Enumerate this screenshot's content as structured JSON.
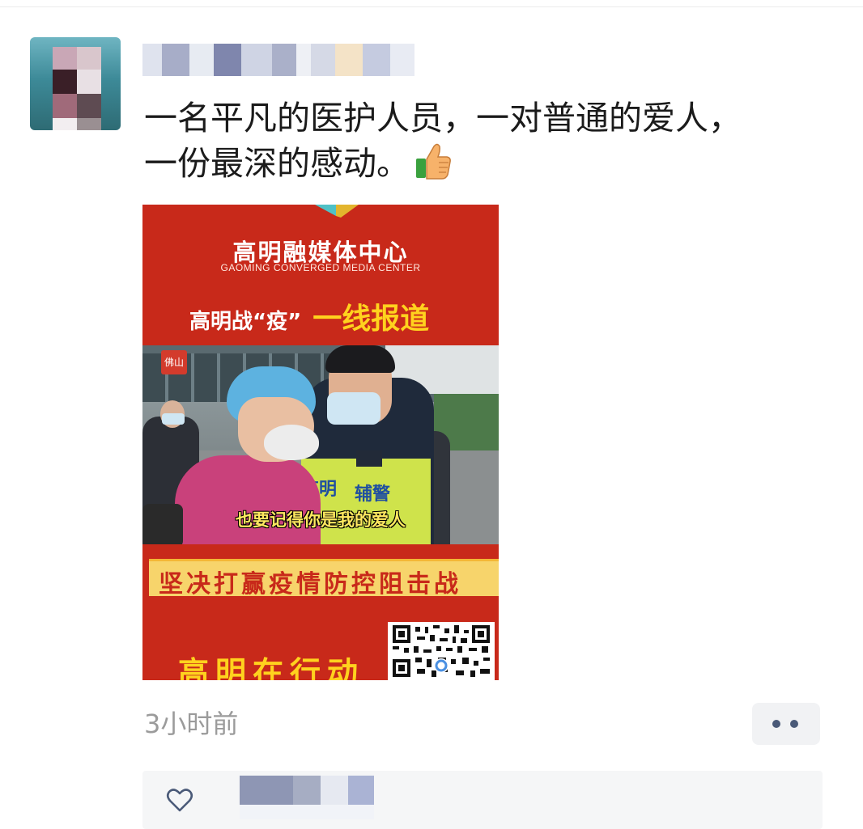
{
  "post": {
    "text_line1": "一名平凡的医护人员，一对普通的爱人，",
    "text_line2": "一份最深的感动。",
    "emoji": "thumbs-up-icon",
    "timestamp": "3小时前"
  },
  "image": {
    "title": "高明融媒体中心",
    "subtitle": "GAOMING CONVERGED MEDIA CENTER",
    "report_white": "高明战“疫”",
    "report_yellow": "一线报道",
    "badge": "佛山",
    "caption": "也要记得你是我的爱人",
    "vest_left": "高明",
    "vest_right": "辅警",
    "banner": "坚决打赢疫情防控阻击战",
    "action": "高明在行动"
  },
  "colors": {
    "poster_red": "#c8291a",
    "poster_yellow": "#ffd21e",
    "timestamp_gray": "#9b9b9b"
  }
}
